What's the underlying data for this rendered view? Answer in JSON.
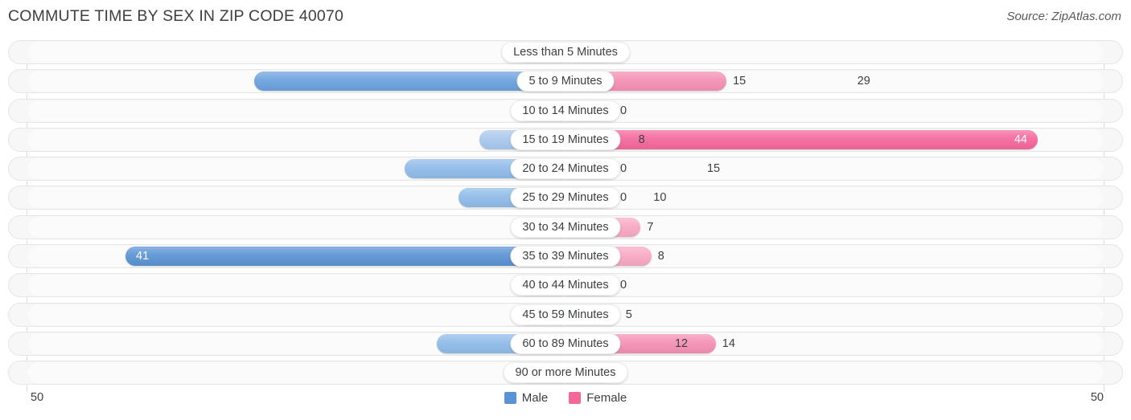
{
  "header": {
    "title": "COMMUTE TIME BY SEX IN ZIP CODE 40070",
    "source": "Source: ZipAtlas.com"
  },
  "axis": {
    "left_tick": "50",
    "right_tick": "50"
  },
  "legend": {
    "items": [
      {
        "label": "Male",
        "color": "#5a93d4"
      },
      {
        "label": "Female",
        "color": "#f4679b"
      }
    ]
  },
  "colors": {
    "male_light": "#a8c8ec",
    "male_dark": "#6ba1dd",
    "male_darkest": "#5a93d4",
    "female_light": "#f9a8c4",
    "female_mid": "#f48fb3",
    "female_dark": "#f4679b",
    "track_bg": "#f7f7f7",
    "track_border": "#e6e6e6",
    "axis": "#dcdcdc",
    "text": "#3c4043"
  },
  "chart_data": {
    "type": "bar",
    "title": "COMMUTE TIME BY SEX IN ZIP CODE 40070",
    "subtitle": "",
    "orientation": "horizontal-diverging",
    "xlabel": "",
    "ylabel": "",
    "xlim": [
      -50,
      50
    ],
    "axis_max": 50,
    "grid": false,
    "legend_position": "bottom-center",
    "categories": [
      "Less than 5 Minutes",
      "5 to 9 Minutes",
      "10 to 14 Minutes",
      "15 to 19 Minutes",
      "20 to 24 Minutes",
      "25 to 29 Minutes",
      "30 to 34 Minutes",
      "35 to 39 Minutes",
      "40 to 44 Minutes",
      "45 to 59 Minutes",
      "60 to 89 Minutes",
      "90 or more Minutes"
    ],
    "series": [
      {
        "name": "Male",
        "side": "left",
        "color": "#5a93d4",
        "values": [
          0,
          29,
          0,
          8,
          15,
          10,
          4,
          41,
          0,
          0,
          12,
          0
        ]
      },
      {
        "name": "Female",
        "side": "right",
        "color": "#f4679b",
        "values": [
          0,
          15,
          0,
          44,
          0,
          0,
          7,
          8,
          0,
          5,
          14,
          0
        ]
      }
    ]
  },
  "rows": [
    {
      "category": "Less than 5 Minutes",
      "male": "0",
      "female": "0",
      "male_value": 0,
      "female_value": 0,
      "male_color": "#a8c8ec",
      "female_color": "#f9a8c4",
      "male_inside": false,
      "female_inside": false
    },
    {
      "category": "5 to 9 Minutes",
      "male": "29",
      "female": "15",
      "male_value": 29,
      "female_value": 15,
      "male_color": "#6ba1dd",
      "female_color": "#f48fb3",
      "male_inside": false,
      "female_inside": false
    },
    {
      "category": "10 to 14 Minutes",
      "male": "0",
      "female": "0",
      "male_value": 0,
      "female_value": 0,
      "male_color": "#a8c8ec",
      "female_color": "#f9a8c4",
      "male_inside": false,
      "female_inside": false
    },
    {
      "category": "15 to 19 Minutes",
      "male": "8",
      "female": "44",
      "male_value": 8,
      "female_value": 44,
      "male_color": "#a8c8ec",
      "female_color": "#f4679b",
      "male_inside": false,
      "female_inside": true
    },
    {
      "category": "20 to 24 Minutes",
      "male": "15",
      "female": "0",
      "male_value": 15,
      "female_value": 0,
      "male_color": "#8fbbe8",
      "female_color": "#f9a8c4",
      "male_inside": false,
      "female_inside": false
    },
    {
      "category": "25 to 29 Minutes",
      "male": "10",
      "female": "0",
      "male_value": 10,
      "female_value": 0,
      "male_color": "#8fbbe8",
      "female_color": "#f9a8c4",
      "male_inside": false,
      "female_inside": false
    },
    {
      "category": "30 to 34 Minutes",
      "male": "4",
      "female": "7",
      "male_value": 4,
      "female_value": 7,
      "male_color": "#a8c8ec",
      "female_color": "#f9a8c4",
      "male_inside": false,
      "female_inside": false
    },
    {
      "category": "35 to 39 Minutes",
      "male": "41",
      "female": "8",
      "male_value": 41,
      "female_value": 8,
      "male_color": "#5a93d4",
      "female_color": "#f9a8c4",
      "male_inside": true,
      "female_inside": false
    },
    {
      "category": "40 to 44 Minutes",
      "male": "0",
      "female": "0",
      "male_value": 0,
      "female_value": 0,
      "male_color": "#a8c8ec",
      "female_color": "#f9a8c4",
      "male_inside": false,
      "female_inside": false
    },
    {
      "category": "45 to 59 Minutes",
      "male": "0",
      "female": "5",
      "male_value": 0,
      "female_value": 5,
      "male_color": "#a8c8ec",
      "female_color": "#f48fb3",
      "male_inside": false,
      "female_inside": false
    },
    {
      "category": "60 to 89 Minutes",
      "male": "12",
      "female": "14",
      "male_value": 12,
      "female_value": 14,
      "male_color": "#8fbbe8",
      "female_color": "#f48fb3",
      "male_inside": false,
      "female_inside": false
    },
    {
      "category": "90 or more Minutes",
      "male": "0",
      "female": "0",
      "male_value": 0,
      "female_value": 0,
      "male_color": "#a8c8ec",
      "female_color": "#f9a8c4",
      "male_inside": false,
      "female_inside": false
    }
  ]
}
